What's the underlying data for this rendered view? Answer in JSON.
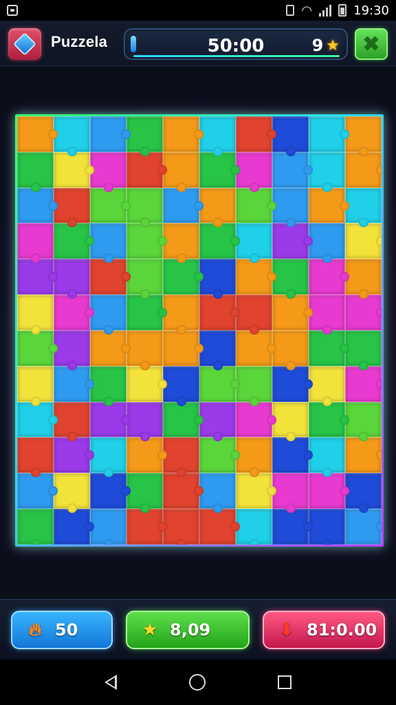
{
  "status_bar": {
    "time": "19:30"
  },
  "header": {
    "app_name": "Puzzela",
    "timer": "50:00",
    "star_count": "9",
    "icons": {
      "app": "gem-shield-icon",
      "close": "close-x-icon",
      "star": "star-icon"
    }
  },
  "board": {
    "columns": 10,
    "rows": 12,
    "hint_icon": "hint-diamond-icon",
    "palette": [
      "#e0432e",
      "#2f9bf0",
      "#27c447",
      "#9a3ae8",
      "#f59a18",
      "#1fd0e8",
      "#e83ad0",
      "#f2e23a",
      "#1e4bd8",
      "#5ad63a"
    ]
  },
  "bottom_bar": {
    "blue": {
      "value": "50",
      "icon": "flame-icon"
    },
    "green": {
      "value": "8,09",
      "icon": "star-icon"
    },
    "red": {
      "value": "81:0.00",
      "icon": "arrow-down-icon"
    }
  },
  "nav": {
    "back": "back-icon",
    "home": "home-icon",
    "recent": "recents-icon"
  }
}
